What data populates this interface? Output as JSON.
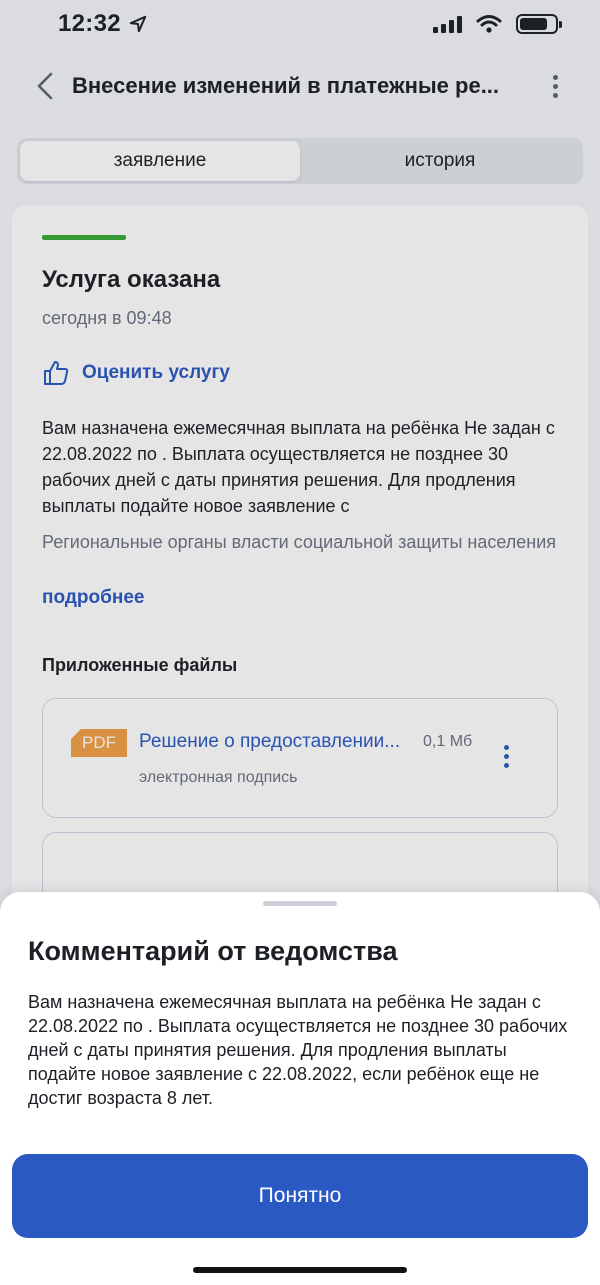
{
  "status_bar": {
    "time": "12:32",
    "battery_level": 0.8
  },
  "header": {
    "title": "Внесение изменений в платежные ре..."
  },
  "tabs": [
    {
      "label": "заявление",
      "active": true
    },
    {
      "label": "история",
      "active": false
    }
  ],
  "card": {
    "status_title": "Услуга оказана",
    "status_date": "сегодня в 09:48",
    "rate_label": "Оценить услугу",
    "body_text": "Вам назначена ежемесячная выплата на ребёнка Не задан с 22.08.2022 по . Выплата осуществляется не позднее 30 рабочих дней с даты принятия решения. Для продления выплаты подайте новое заявление с",
    "org_text": "Региональные органы власти социальной защиты населения",
    "more_link": "подробнее",
    "files_title": "Приложенные файлы",
    "file": {
      "type_badge": "PDF",
      "name": "Решение о предоставлении...",
      "size": "0,1 Мб",
      "subtitle": "электронная подпись"
    }
  },
  "sheet": {
    "title": "Комментарий от ведомства",
    "text": "Вам назначена ежемесячная выплата на ребёнка Не задан с 22.08.2022 по . Выплата осуществляется не позднее 30 рабочих дней с даты принятия решения. Для продления выплаты подайте новое заявление с 22.08.2022, если ребёнок еще не достиг возраста 8 лет.",
    "button_label": "Понятно"
  },
  "colors": {
    "accent": "#2b59c3",
    "success": "#3aaa35",
    "pdf": "#f0a043"
  }
}
